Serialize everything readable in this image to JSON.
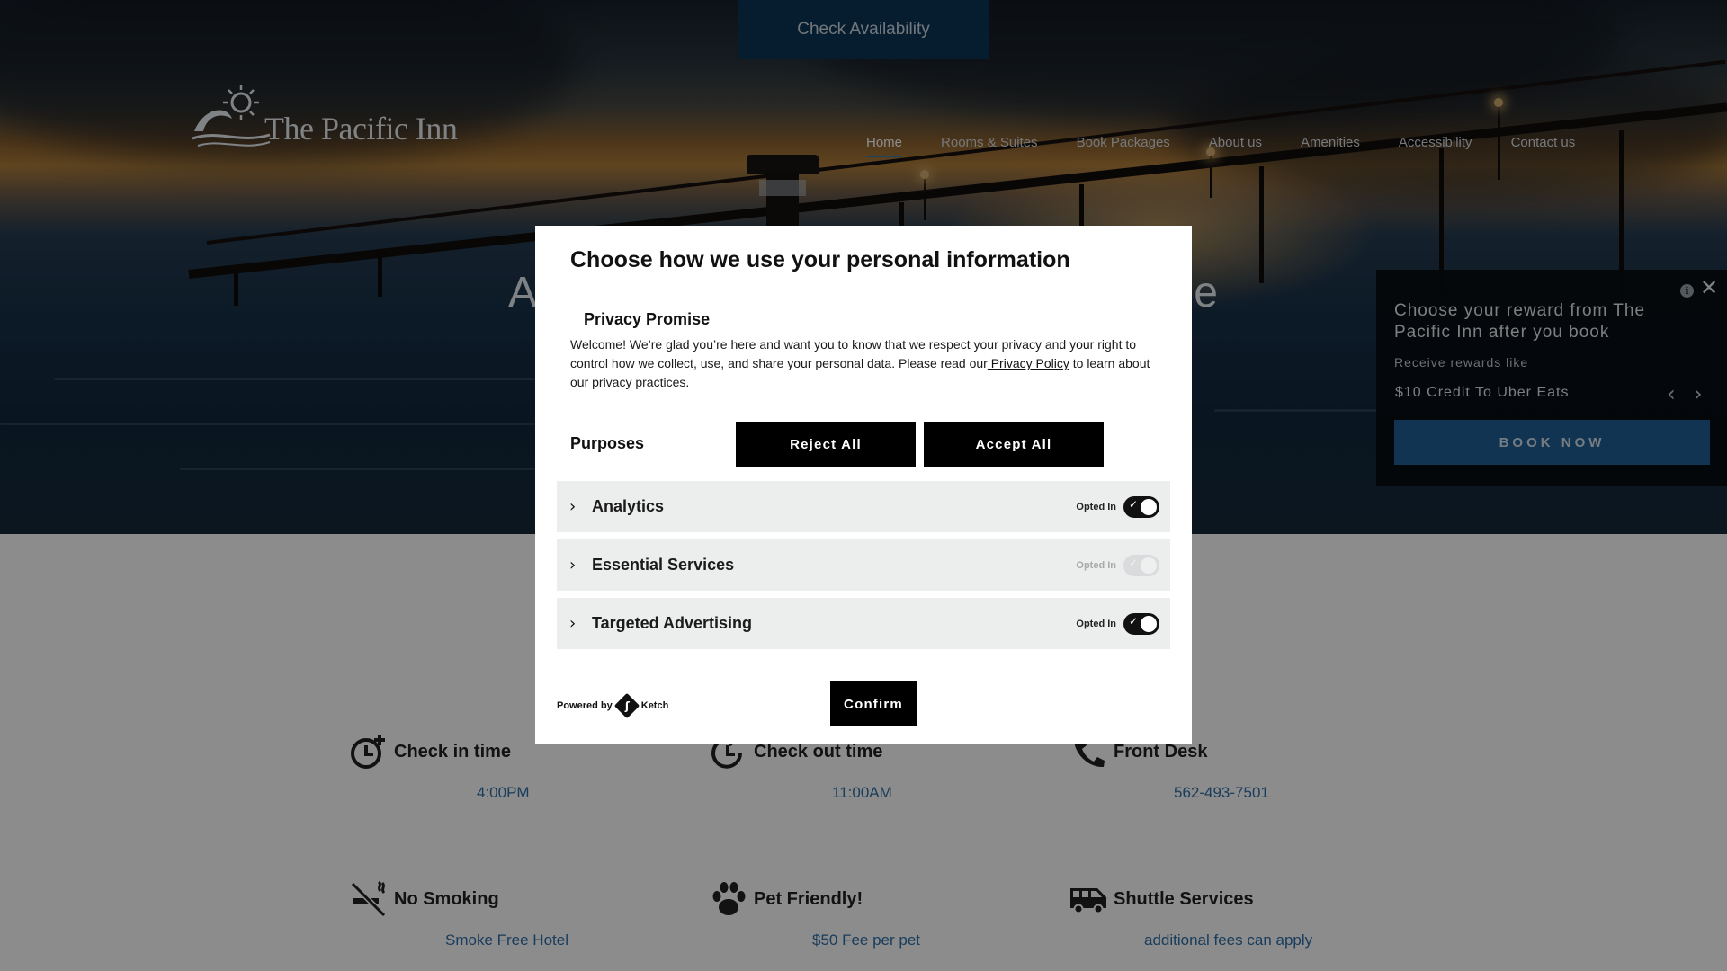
{
  "top_bar": {
    "check_availability": "Check Availability"
  },
  "logo": {
    "text": "The Pacific Inn"
  },
  "nav": {
    "items": [
      "Home",
      "Rooms & Suites",
      "Book Packages",
      "About us",
      "Amenities",
      "Accessibility",
      "Contact us"
    ],
    "active": "Home"
  },
  "hero": {
    "title_left": "A",
    "title_right": "e"
  },
  "rewards": {
    "title": "Choose your reward from The Pacific Inn after you book",
    "subtitle": "Receive rewards like",
    "offer": "$10 Credit To Uber Eats",
    "book_now": "BOOK NOW",
    "info_icon": "info-icon",
    "close_icon": "close-icon"
  },
  "amenities": [
    {
      "title": "Check in time",
      "value": "4:00PM",
      "icon": "clock-plus-icon"
    },
    {
      "title": "Check out time",
      "value": "11:00AM",
      "icon": "clock-arrow-icon"
    },
    {
      "title": "Front Desk",
      "value": "562-493-7501",
      "icon": "phone-icon"
    },
    {
      "title": "No Smoking",
      "value": "Smoke Free Hotel",
      "icon": "no-smoking-icon"
    },
    {
      "title": "Pet Friendly!",
      "value": "$50 Fee per pet",
      "icon": "paw-icon"
    },
    {
      "title": "Shuttle Services",
      "value": "additional fees can apply",
      "icon": "shuttle-van-icon"
    }
  ],
  "consent_modal": {
    "title": "Choose how we use your personal information",
    "privacy_title": "Privacy Promise",
    "privacy_text_before": "Welcome! We’re glad you’re here and want you to know that we respect your privacy and your right to control how we collect, use, and share your personal data. Please read our",
    "privacy_link": " Privacy Policy",
    "privacy_text_after": " to learn about our privacy practices.",
    "purposes_label": "Purposes",
    "reject_all": "Reject All",
    "accept_all": "Accept All",
    "purposes": [
      {
        "label": "Analytics",
        "status": "Opted In",
        "enabled": true,
        "locked": false
      },
      {
        "label": "Essential Services",
        "status": "Opted In",
        "enabled": true,
        "locked": true
      },
      {
        "label": "Targeted Advertising",
        "status": "Opted In",
        "enabled": true,
        "locked": false
      }
    ],
    "powered_by": "Powered by",
    "powered_brand": "Ketch",
    "confirm": "Confirm"
  },
  "colors": {
    "primary_blue": "#1f5f95",
    "check_avail_bg": "#0b3556",
    "link_blue": "#2f6fa8",
    "modal_button": "#000000",
    "purpose_row_bg": "#eceeed"
  }
}
